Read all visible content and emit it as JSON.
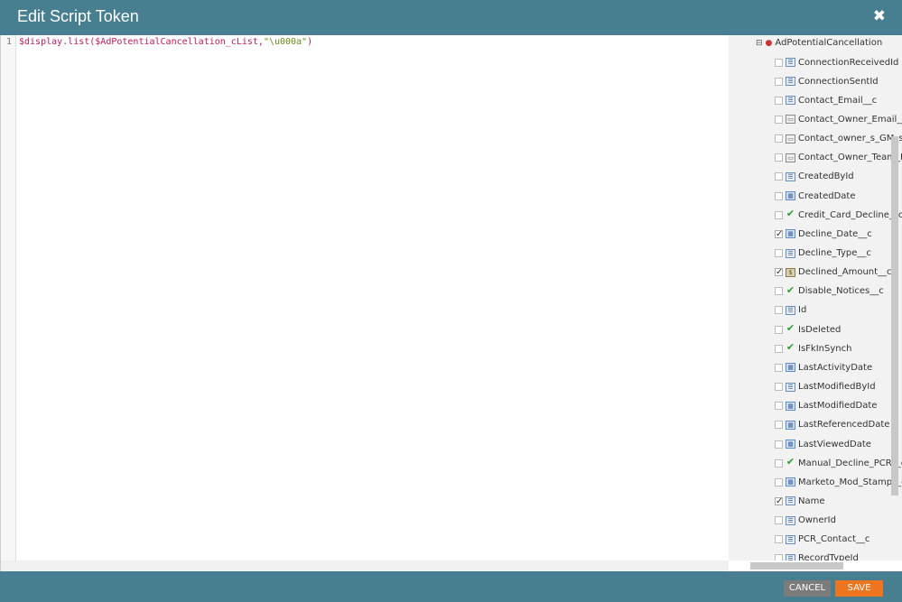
{
  "dialog": {
    "title": "Edit Script Token",
    "close_icon": "close-icon"
  },
  "editor": {
    "line_number": "1",
    "code_prefix": "$display.list($AdPotentialCancellation_cList,",
    "code_string": "\"\\u000a\"",
    "code_suffix": ")"
  },
  "tree": {
    "root_label": "AdPotentialCancellation",
    "fields": [
      {
        "label": "ConnectionReceivedId",
        "type": "id",
        "checked": false
      },
      {
        "label": "ConnectionSentId",
        "type": "id",
        "checked": false
      },
      {
        "label": "Contact_Email__c",
        "type": "id",
        "checked": false
      },
      {
        "label": "Contact_Owner_Email__",
        "type": "string",
        "checked": false
      },
      {
        "label": "Contact_owner_s_GM_s_",
        "type": "string",
        "checked": false
      },
      {
        "label": "Contact_Owner_Team_L",
        "type": "string",
        "checked": false
      },
      {
        "label": "CreatedById",
        "type": "id",
        "checked": false
      },
      {
        "label": "CreatedDate",
        "type": "date",
        "checked": false
      },
      {
        "label": "Credit_Card_Decline__c",
        "type": "bool",
        "checked": false
      },
      {
        "label": "Decline_Date__c",
        "type": "date",
        "checked": true
      },
      {
        "label": "Decline_Type__c",
        "type": "id",
        "checked": false
      },
      {
        "label": "Declined_Amount__c",
        "type": "currency",
        "checked": true
      },
      {
        "label": "Disable_Notices__c",
        "type": "bool",
        "checked": false
      },
      {
        "label": "Id",
        "type": "id",
        "checked": false
      },
      {
        "label": "IsDeleted",
        "type": "bool",
        "checked": false
      },
      {
        "label": "IsFkInSynch",
        "type": "bool",
        "checked": false
      },
      {
        "label": "LastActivityDate",
        "type": "date",
        "checked": false
      },
      {
        "label": "LastModifiedById",
        "type": "id",
        "checked": false
      },
      {
        "label": "LastModifiedDate",
        "type": "date",
        "checked": false
      },
      {
        "label": "LastReferencedDate",
        "type": "date",
        "checked": false
      },
      {
        "label": "LastViewedDate",
        "type": "date",
        "checked": false
      },
      {
        "label": "Manual_Decline_PCR__c",
        "type": "bool",
        "checked": false
      },
      {
        "label": "Marketo_Mod_Stamp__c",
        "type": "date",
        "checked": false
      },
      {
        "label": "Name",
        "type": "id",
        "checked": true
      },
      {
        "label": "OwnerId",
        "type": "id",
        "checked": false
      },
      {
        "label": "PCR_Contact__c",
        "type": "id",
        "checked": false
      },
      {
        "label": "RecordTypeId",
        "type": "id",
        "checked": false
      }
    ]
  },
  "footer": {
    "cancel_label": "CANCEL",
    "save_label": "SAVE"
  },
  "colors": {
    "header": "#477f91",
    "save": "#ee7520",
    "cancel": "#7b7b7b"
  }
}
